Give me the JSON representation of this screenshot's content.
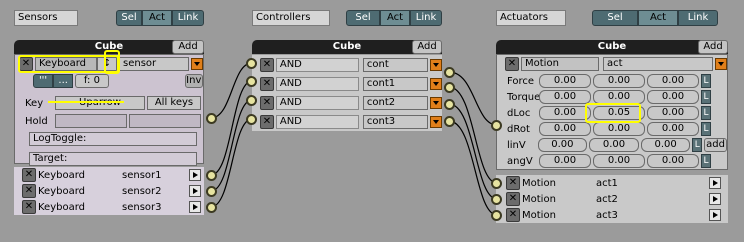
{
  "header": {
    "sensors_label": "Sensors",
    "controllers_label": "Controllers",
    "actuators_label": "Actuators",
    "toggles": [
      "Sel",
      "Act",
      "Link"
    ]
  },
  "sensors": {
    "title": "Cube",
    "add_label": "Add",
    "main": {
      "type": "Keyboard",
      "name": "sensor",
      "pulse_a": "'''",
      "pulse_b": "...",
      "freq": "f: 0",
      "inv_label": "Inv",
      "key_label": "Key",
      "key_value": "Uparrow",
      "all_keys_label": "All keys",
      "hold_label": "Hold",
      "logtoggle_label": "LogToggle:",
      "target_label": "Target:"
    },
    "list": [
      {
        "type": "Keyboard",
        "name": "sensor1"
      },
      {
        "type": "Keyboard",
        "name": "sensor2"
      },
      {
        "type": "Keyboard",
        "name": "sensor3"
      }
    ]
  },
  "controllers": {
    "title": "Cube",
    "add_label": "Add",
    "list": [
      {
        "type": "AND",
        "name": "cont"
      },
      {
        "type": "AND",
        "name": "cont1"
      },
      {
        "type": "AND",
        "name": "cont2"
      },
      {
        "type": "AND",
        "name": "cont3"
      }
    ]
  },
  "actuators": {
    "title": "Cube",
    "add_label": "Add",
    "main": {
      "type": "Motion",
      "name": "act",
      "add_label": "add",
      "rows": [
        {
          "label": "Force",
          "v": [
            "0.00",
            "0.00",
            "0.00"
          ]
        },
        {
          "label": "Torque",
          "v": [
            "0.00",
            "0.00",
            "0.00"
          ]
        },
        {
          "label": "dLoc",
          "v": [
            "0.00",
            "0.05",
            "0.00"
          ]
        },
        {
          "label": "dRot",
          "v": [
            "0.00",
            "0.00",
            "0.00"
          ]
        },
        {
          "label": "linV",
          "v": [
            "0.00",
            "0.00",
            "0.00"
          ]
        },
        {
          "label": "angV",
          "v": [
            "0.00",
            "0.00",
            "0.00"
          ]
        }
      ]
    },
    "list": [
      {
        "type": "Motion",
        "name": "act1"
      },
      {
        "type": "Motion",
        "name": "act2"
      },
      {
        "type": "Motion",
        "name": "act3"
      }
    ]
  }
}
